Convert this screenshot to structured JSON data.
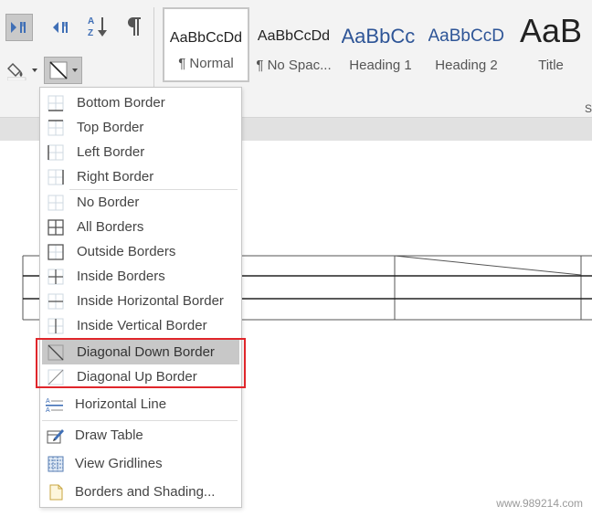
{
  "ribbon": {
    "styles": [
      {
        "preview": "AaBbCcDd",
        "name": "¶ Normal",
        "selected": true
      },
      {
        "preview": "AaBbCcDd",
        "name": "¶ No Spac...",
        "selected": false
      },
      {
        "preview": "AaBbCc",
        "name": "Heading 1",
        "selected": false
      },
      {
        "preview": "AaBbCcD",
        "name": "Heading 2",
        "selected": false
      },
      {
        "preview": "AaB",
        "name": "Title",
        "selected": false
      }
    ],
    "styles_group_label": "S"
  },
  "border_menu": {
    "items": [
      {
        "label": "Bottom Border",
        "icon": "bottom-border-icon"
      },
      {
        "label": "Top Border",
        "icon": "top-border-icon"
      },
      {
        "label": "Left Border",
        "icon": "left-border-icon"
      },
      {
        "label": "Right Border",
        "icon": "right-border-icon"
      },
      {
        "label": "No Border",
        "icon": "no-border-icon"
      },
      {
        "label": "All Borders",
        "icon": "all-borders-icon"
      },
      {
        "label": "Outside Borders",
        "icon": "outside-borders-icon"
      },
      {
        "label": "Inside Borders",
        "icon": "inside-borders-icon"
      },
      {
        "label": "Inside Horizontal Border",
        "icon": "inside-horizontal-border-icon"
      },
      {
        "label": "Inside Vertical Border",
        "icon": "inside-vertical-border-icon"
      },
      {
        "label": "Diagonal Down Border",
        "icon": "diagonal-down-border-icon",
        "hover": true
      },
      {
        "label": "Diagonal Up Border",
        "icon": "diagonal-up-border-icon"
      },
      {
        "label": "Horizontal Line",
        "icon": "horizontal-line-icon"
      },
      {
        "label": "Draw Table",
        "icon": "draw-table-icon"
      },
      {
        "label": "View Gridlines",
        "icon": "view-gridlines-icon"
      },
      {
        "label": "Borders and Shading...",
        "icon": "borders-and-shading-icon"
      }
    ]
  },
  "watermark": "www.989214.com",
  "colors": {
    "highlight": "#e0262b",
    "hover": "#c8c8c8",
    "ribbon_bg": "#f3f3f3",
    "heading_blue": "#2e5597"
  }
}
